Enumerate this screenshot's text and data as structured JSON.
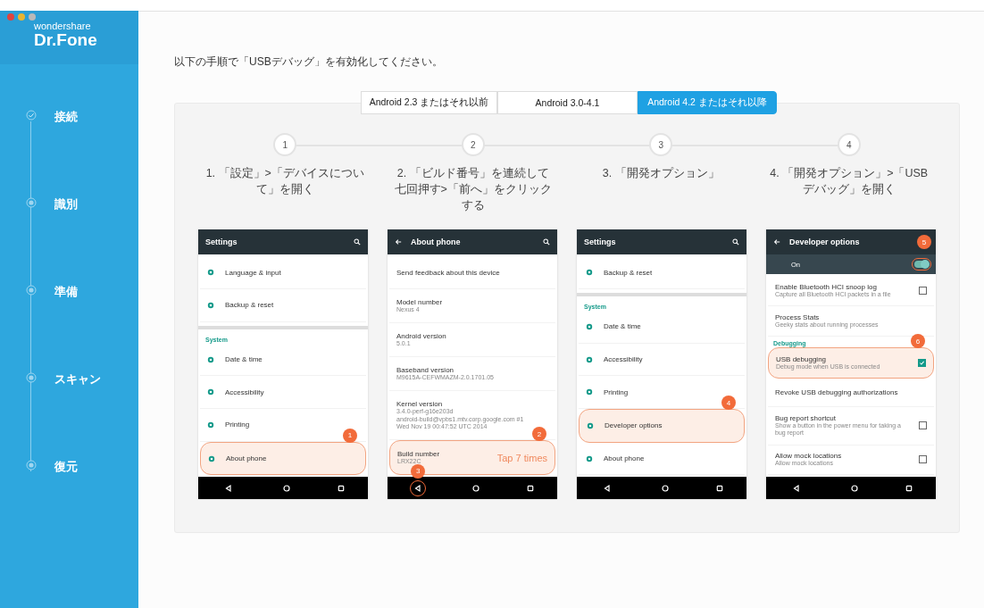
{
  "window": {
    "logo_top": "wondershare",
    "logo_bottom": "Dr.Fone"
  },
  "sidebar": {
    "items": [
      {
        "label": "接続",
        "done": true
      },
      {
        "label": "識別",
        "done": false
      },
      {
        "label": "準備",
        "done": false
      },
      {
        "label": "スキャン",
        "done": false
      },
      {
        "label": "復元",
        "done": false
      }
    ]
  },
  "instruction": "以下の手順で「USBデバッグ」を有効化してください。",
  "tabs": [
    {
      "label": "Android 2.3 またはそれ以前",
      "selected": false
    },
    {
      "label": "Android 3.0-4.1",
      "selected": false
    },
    {
      "label": "Android 4.2 またはそれ以降",
      "selected": true
    }
  ],
  "steps": [
    {
      "number": "1",
      "label": "1. 「設定」>「デバイスについて」を開く"
    },
    {
      "number": "2",
      "label": "2. 「ビルド番号」を連続して七回押す>「前へ」をクリックする"
    },
    {
      "number": "3",
      "label": "3. 「開発オプション」"
    },
    {
      "number": "4",
      "label": "4. 「開発オプション」>「USBデバッグ」を開く"
    }
  ],
  "phones": [
    {
      "title": "Settings",
      "back": false,
      "search": true,
      "rows": [
        {
          "kind": "row",
          "title": "Language & input",
          "icon": true,
          "highlighted": false
        },
        {
          "kind": "row",
          "title": "Backup & reset",
          "icon": true,
          "highlighted": false
        },
        {
          "kind": "divider"
        },
        {
          "kind": "section",
          "title": "System"
        },
        {
          "kind": "row",
          "title": "Date & time",
          "icon": true,
          "highlighted": false
        },
        {
          "kind": "row",
          "title": "Accessibility",
          "icon": true,
          "highlighted": false
        },
        {
          "kind": "row",
          "title": "Printing",
          "icon": true,
          "highlighted": false
        },
        {
          "kind": "row",
          "title": "About phone",
          "icon": true,
          "highlighted": true,
          "marker": "1"
        }
      ]
    },
    {
      "title": "About phone",
      "back": true,
      "search": true,
      "nav_marker": "3",
      "rows": [
        {
          "kind": "row",
          "title": "Send feedback about this device",
          "highlighted": false
        },
        {
          "kind": "row",
          "title": "Model number",
          "subtitle": "Nexus 4",
          "highlighted": false
        },
        {
          "kind": "row",
          "title": "Android version",
          "subtitle": "5.0.1",
          "highlighted": false
        },
        {
          "kind": "row",
          "title": "Baseband version",
          "subtitle": "M9615A-CEFWMAZM-2.0.1701.05",
          "highlighted": false
        },
        {
          "kind": "row",
          "title": "Kernel version",
          "subtitle": "3.4.0-perf-g16e203d\nandroid-build@vpbs1.mtv.corp.google.com #1\nWed Nov 19 00:47:52 UTC 2014",
          "highlighted": false
        },
        {
          "kind": "row",
          "title": "Build number",
          "subtitle": "LRX22C",
          "note": "Tap 7 times",
          "highlighted": true,
          "marker": "2"
        }
      ]
    },
    {
      "title": "Settings",
      "back": false,
      "search": true,
      "rows": [
        {
          "kind": "row",
          "title": "Backup & reset",
          "icon": true,
          "highlighted": false
        },
        {
          "kind": "divider"
        },
        {
          "kind": "section",
          "title": "System"
        },
        {
          "kind": "row",
          "title": "Date & time",
          "icon": true,
          "highlighted": false
        },
        {
          "kind": "row",
          "title": "Accessibility",
          "icon": true,
          "highlighted": false
        },
        {
          "kind": "row",
          "title": "Printing",
          "icon": true,
          "highlighted": false
        },
        {
          "kind": "row",
          "title": "Developer options",
          "icon": true,
          "highlighted": true,
          "marker": "4"
        },
        {
          "kind": "row",
          "title": "About phone",
          "icon": true,
          "highlighted": false
        }
      ]
    },
    {
      "title": "Developer options",
      "back": true,
      "search": false,
      "switch": {
        "label": "On",
        "on": true,
        "marker": "5"
      },
      "rows": [
        {
          "kind": "row",
          "title": "Enable Bluetooth HCI snoop log",
          "subtitle": "Capture all Bluetooth HCI packets in a file",
          "checked": false,
          "highlighted": false
        },
        {
          "kind": "row",
          "title": "Process Stats",
          "subtitle": "Geeky stats about running processes",
          "highlighted": false
        },
        {
          "kind": "section",
          "title": "Debugging"
        },
        {
          "kind": "row",
          "title": "USB debugging",
          "subtitle": "Debug mode when USB is connected",
          "checked": true,
          "highlighted": true,
          "marker": "6"
        },
        {
          "kind": "row",
          "title": "Revoke USB debugging authorizations",
          "highlighted": false
        },
        {
          "kind": "row",
          "title": "Bug report shortcut",
          "subtitle": "Show a button in the power menu for taking a bug report",
          "checked": false,
          "highlighted": false
        },
        {
          "kind": "row",
          "title": "Allow mock locations",
          "subtitle": "Allow mock locations",
          "checked": false,
          "highlighted": false
        }
      ]
    }
  ]
}
